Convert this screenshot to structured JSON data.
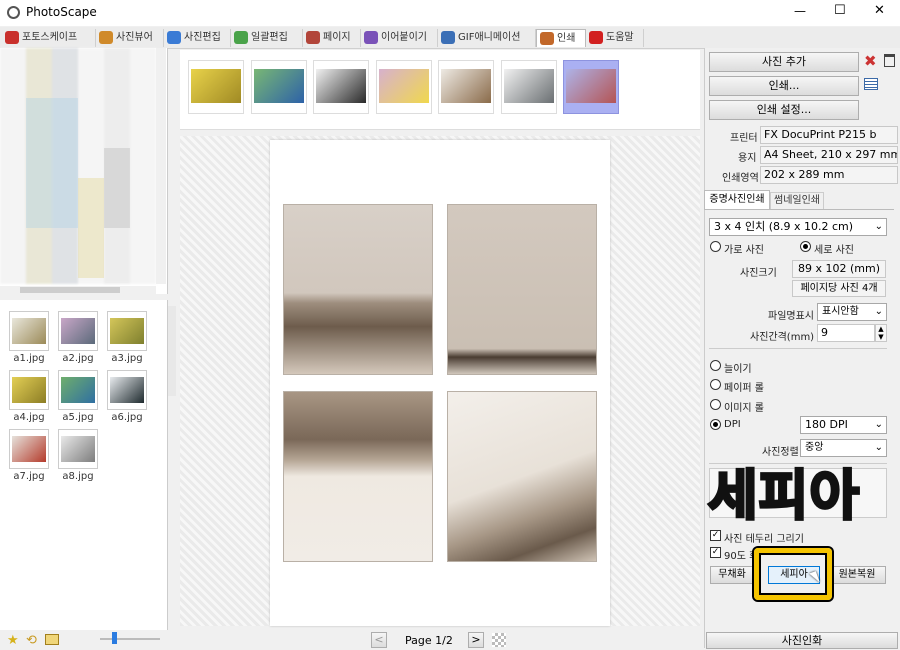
{
  "window": {
    "title": "PhotoScape",
    "min": "—",
    "max": "☐",
    "close": "✕"
  },
  "tabs": [
    {
      "label": "포토스케이프",
      "color": "#c9302c"
    },
    {
      "label": "사진뷰어",
      "color": "#d08a2a"
    },
    {
      "label": "사진편집",
      "color": "#3a7bd5"
    },
    {
      "label": "일괄편집",
      "color": "#4aa34a"
    },
    {
      "label": "페이지",
      "color": "#b2453a"
    },
    {
      "label": "이어붙이기",
      "color": "#7a52b8"
    },
    {
      "label": "GIF애니메이션",
      "color": "#3b6fb6"
    },
    {
      "label": "인쇄",
      "color": "#c2682a"
    },
    {
      "label": "도움말",
      "color": "#d22020"
    }
  ],
  "files": [
    {
      "name": "a1.jpg",
      "bg": "linear-gradient(135deg,#e9e7dc,#9b8a58)"
    },
    {
      "name": "a2.jpg",
      "bg": "linear-gradient(135deg,#c9a7c8,#5b6a7a)"
    },
    {
      "name": "a3.jpg",
      "bg": "linear-gradient(135deg,#d4c65a,#7e7f2e)"
    },
    {
      "name": "a4.jpg",
      "bg": "linear-gradient(135deg,#e3cf55,#8c7d25)"
    },
    {
      "name": "a5.jpg",
      "bg": "linear-gradient(135deg,#6fae6c,#2f6fa2)"
    },
    {
      "name": "a6.jpg",
      "bg": "linear-gradient(135deg,#e8ebee,#1e2a2e)"
    },
    {
      "name": "a7.jpg",
      "bg": "linear-gradient(135deg,#e6e2dc,#b43b2b)"
    },
    {
      "name": "a8.jpg",
      "bg": "linear-gradient(135deg,#e9e9e9,#7d7d7d)"
    }
  ],
  "strip": [
    {
      "bg": "linear-gradient(135deg,#e8d24a,#a08a24)"
    },
    {
      "bg": "linear-gradient(135deg,#79b774,#2d62a8)"
    },
    {
      "bg": "linear-gradient(135deg,#f1f1f1,#2a2a2a)"
    },
    {
      "bg": "linear-gradient(135deg,#d7b1cd,#f0d84d)"
    },
    {
      "bg": "linear-gradient(135deg,#eeeae4,#8a6b4a)"
    },
    {
      "bg": "linear-gradient(135deg,#f1f1f1,#6a6f72)"
    },
    {
      "bg": "linear-gradient(135deg,#aeb3e8,#b45454)"
    }
  ],
  "preview": {
    "page_label": "Page 1/2",
    "prev": "<",
    "next": ">"
  },
  "right": {
    "add_photo": "사진 추가",
    "print": "인쇄...",
    "print_settings": "인쇄 설정...",
    "printer_label": "프린터",
    "printer_value": "FX DocuPrint P215 b",
    "paper_label": "용지",
    "paper_value": "A4 Sheet, 210 x 297 mm",
    "area_label": "인쇄영역",
    "area_value": "202 x 289 mm",
    "tab_id": "증명사진인쇄",
    "tab_thumb": "썸네일인쇄",
    "size_select": "3 x 4 인치 (8.9 x 10.2 cm)",
    "landscape": "가로 사진",
    "portrait": "세로 사진",
    "photo_size_label": "사진크기",
    "photo_size_value": "89 x 102 (mm)",
    "per_page": "페이지당 사진 4개",
    "filename_label": "파일명표시",
    "filename_value": "표시안함",
    "gap_label": "사진간격(mm)",
    "gap_value": "9",
    "opt_fill": "늘이기",
    "opt_paper": "페이퍼 롤",
    "opt_image": "이미지 롤",
    "opt_dpi": "DPI",
    "dpi_value": "180 DPI",
    "align_label": "사진정렬",
    "align_value": "중앙",
    "border_check": "사진 테두리 그리기",
    "rotate_check": "90도 회전",
    "btn_gray": "무채화",
    "btn_sepia": "세피아",
    "btn_restore": "원본복원",
    "btn_photo": "사진인화"
  },
  "overlay": {
    "caption": "세피아"
  }
}
